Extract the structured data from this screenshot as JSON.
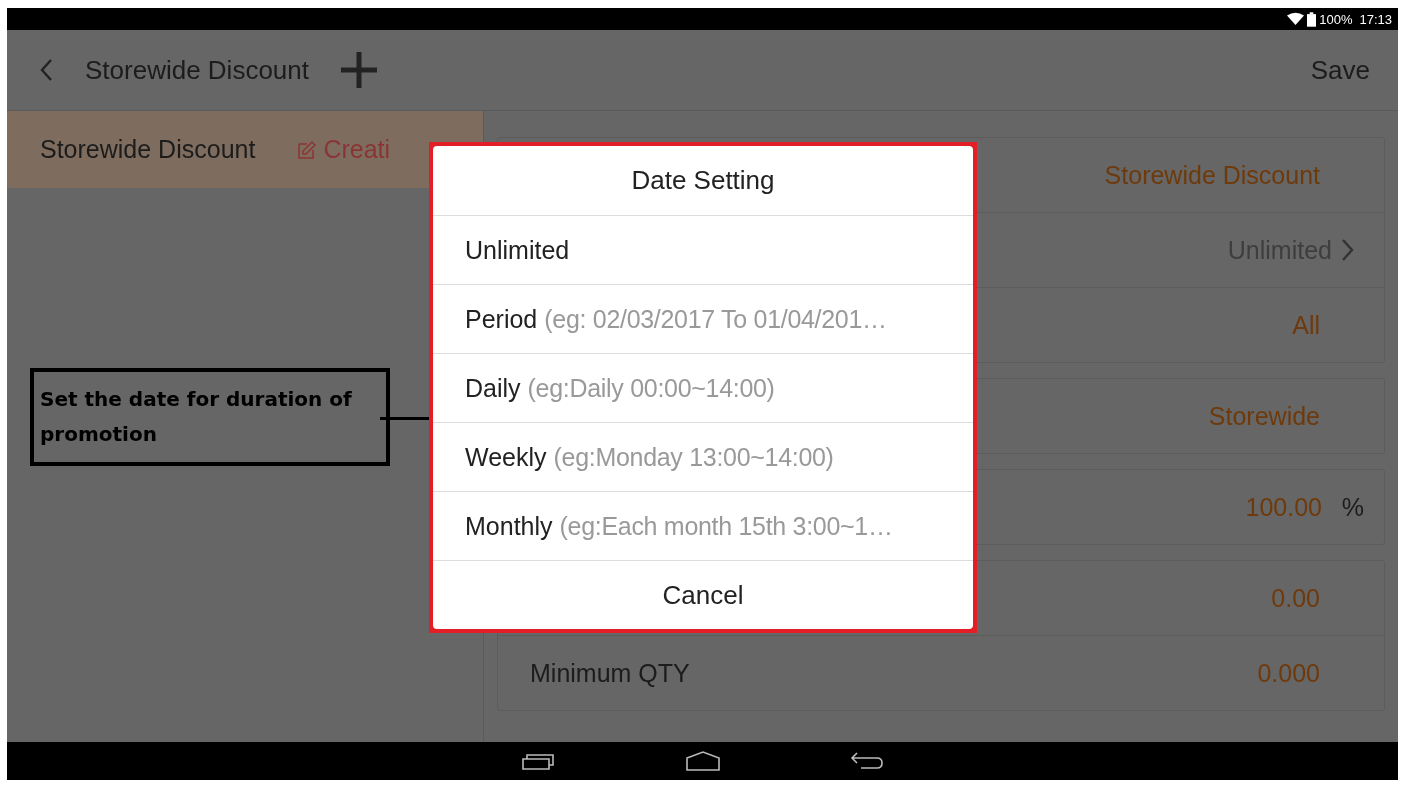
{
  "status_bar": {
    "battery": "100%",
    "time": "17:13"
  },
  "app_bar": {
    "title": "Storewide Discount",
    "action": "Save"
  },
  "promotion_list": [
    {
      "name": "Storewide Discount",
      "status": "Creati",
      "selected": true
    }
  ],
  "form_groups": [
    {
      "rows": [
        {
          "kind": "text",
          "value": "Storewide Discount"
        },
        {
          "kind": "select",
          "value": "Unlimited"
        },
        {
          "kind": "text",
          "value": "All"
        }
      ]
    },
    {
      "rows": [
        {
          "kind": "text",
          "value": "Storewide"
        }
      ]
    },
    {
      "rows": [
        {
          "kind": "text",
          "value": "100.00",
          "unit": "%"
        }
      ]
    },
    {
      "rows": [
        {
          "kind": "text",
          "value": "0.00"
        },
        {
          "kind": "text",
          "label": "Minimum QTY",
          "value": "0.000"
        }
      ]
    }
  ],
  "dialog": {
    "title": "Date Setting",
    "options": [
      {
        "label": "Unlimited"
      },
      {
        "label": "Period",
        "hint": "(eg: 02/03/2017 To 01/04/201…"
      },
      {
        "label": "Daily",
        "hint": "(eg:Daily 00:00~14:00)"
      },
      {
        "label": "Weekly",
        "hint": "(eg:Monday 13:00~14:00)"
      },
      {
        "label": "Monthly",
        "hint": "(eg:Each month 15th 3:00~1…"
      }
    ],
    "cancel": "Cancel"
  },
  "annotation": {
    "text": "Set the date for duration of promotion"
  }
}
